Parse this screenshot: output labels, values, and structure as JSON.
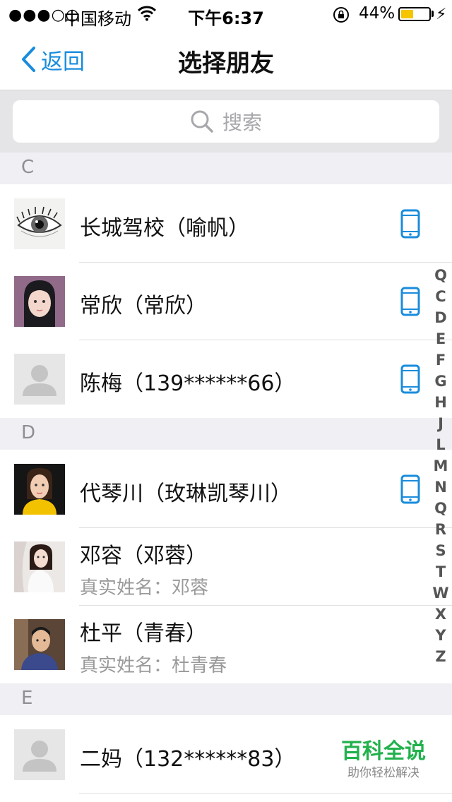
{
  "status_bar": {
    "signal": "●●●○○",
    "carrier": "中国移动",
    "time": "下午6:37",
    "battery_text": "44%",
    "battery_level": 0.44,
    "battery_color": "#f5c500"
  },
  "nav": {
    "back_label": "返回",
    "title": "选择朋友",
    "accent_color": "#1a8cdc"
  },
  "search": {
    "placeholder": "搜索"
  },
  "sections": [
    {
      "letter": "C",
      "contacts": [
        {
          "name": "长城驾校（喻帆）",
          "sub": "",
          "avatar": "eye-sketch-photo",
          "phone": true
        },
        {
          "name": "常欣（常欣）",
          "sub": "",
          "avatar": "girl-portrait-photo",
          "phone": true
        },
        {
          "name": "陈梅（139******66）",
          "sub": "",
          "avatar": "default-person-avatar",
          "phone": true
        }
      ]
    },
    {
      "letter": "D",
      "contacts": [
        {
          "name": "代琴川（玫琳凯琴川）",
          "sub": "",
          "avatar": "girl-yellow-jacket-photo",
          "phone": true
        },
        {
          "name": "邓容（邓蓉）",
          "sub": "真实姓名：邓蓉",
          "avatar": "woman-white-dress-photo",
          "phone": false
        },
        {
          "name": "杜平（青春）",
          "sub": "真实姓名：杜青春",
          "avatar": "man-portrait-photo",
          "phone": false
        }
      ]
    },
    {
      "letter": "E",
      "contacts": [
        {
          "name": "二妈（132******83）",
          "sub": "",
          "avatar": "default-person-avatar",
          "phone": false
        }
      ]
    }
  ],
  "index_letters": [
    "Q",
    "C",
    "D",
    "E",
    "F",
    "G",
    "H",
    "J",
    "L",
    "M",
    "N",
    "Q",
    "R",
    "S",
    "T",
    "W",
    "X",
    "Y",
    "Z"
  ],
  "watermark": {
    "main": "百科全说",
    "sub": "助你轻松解决"
  }
}
